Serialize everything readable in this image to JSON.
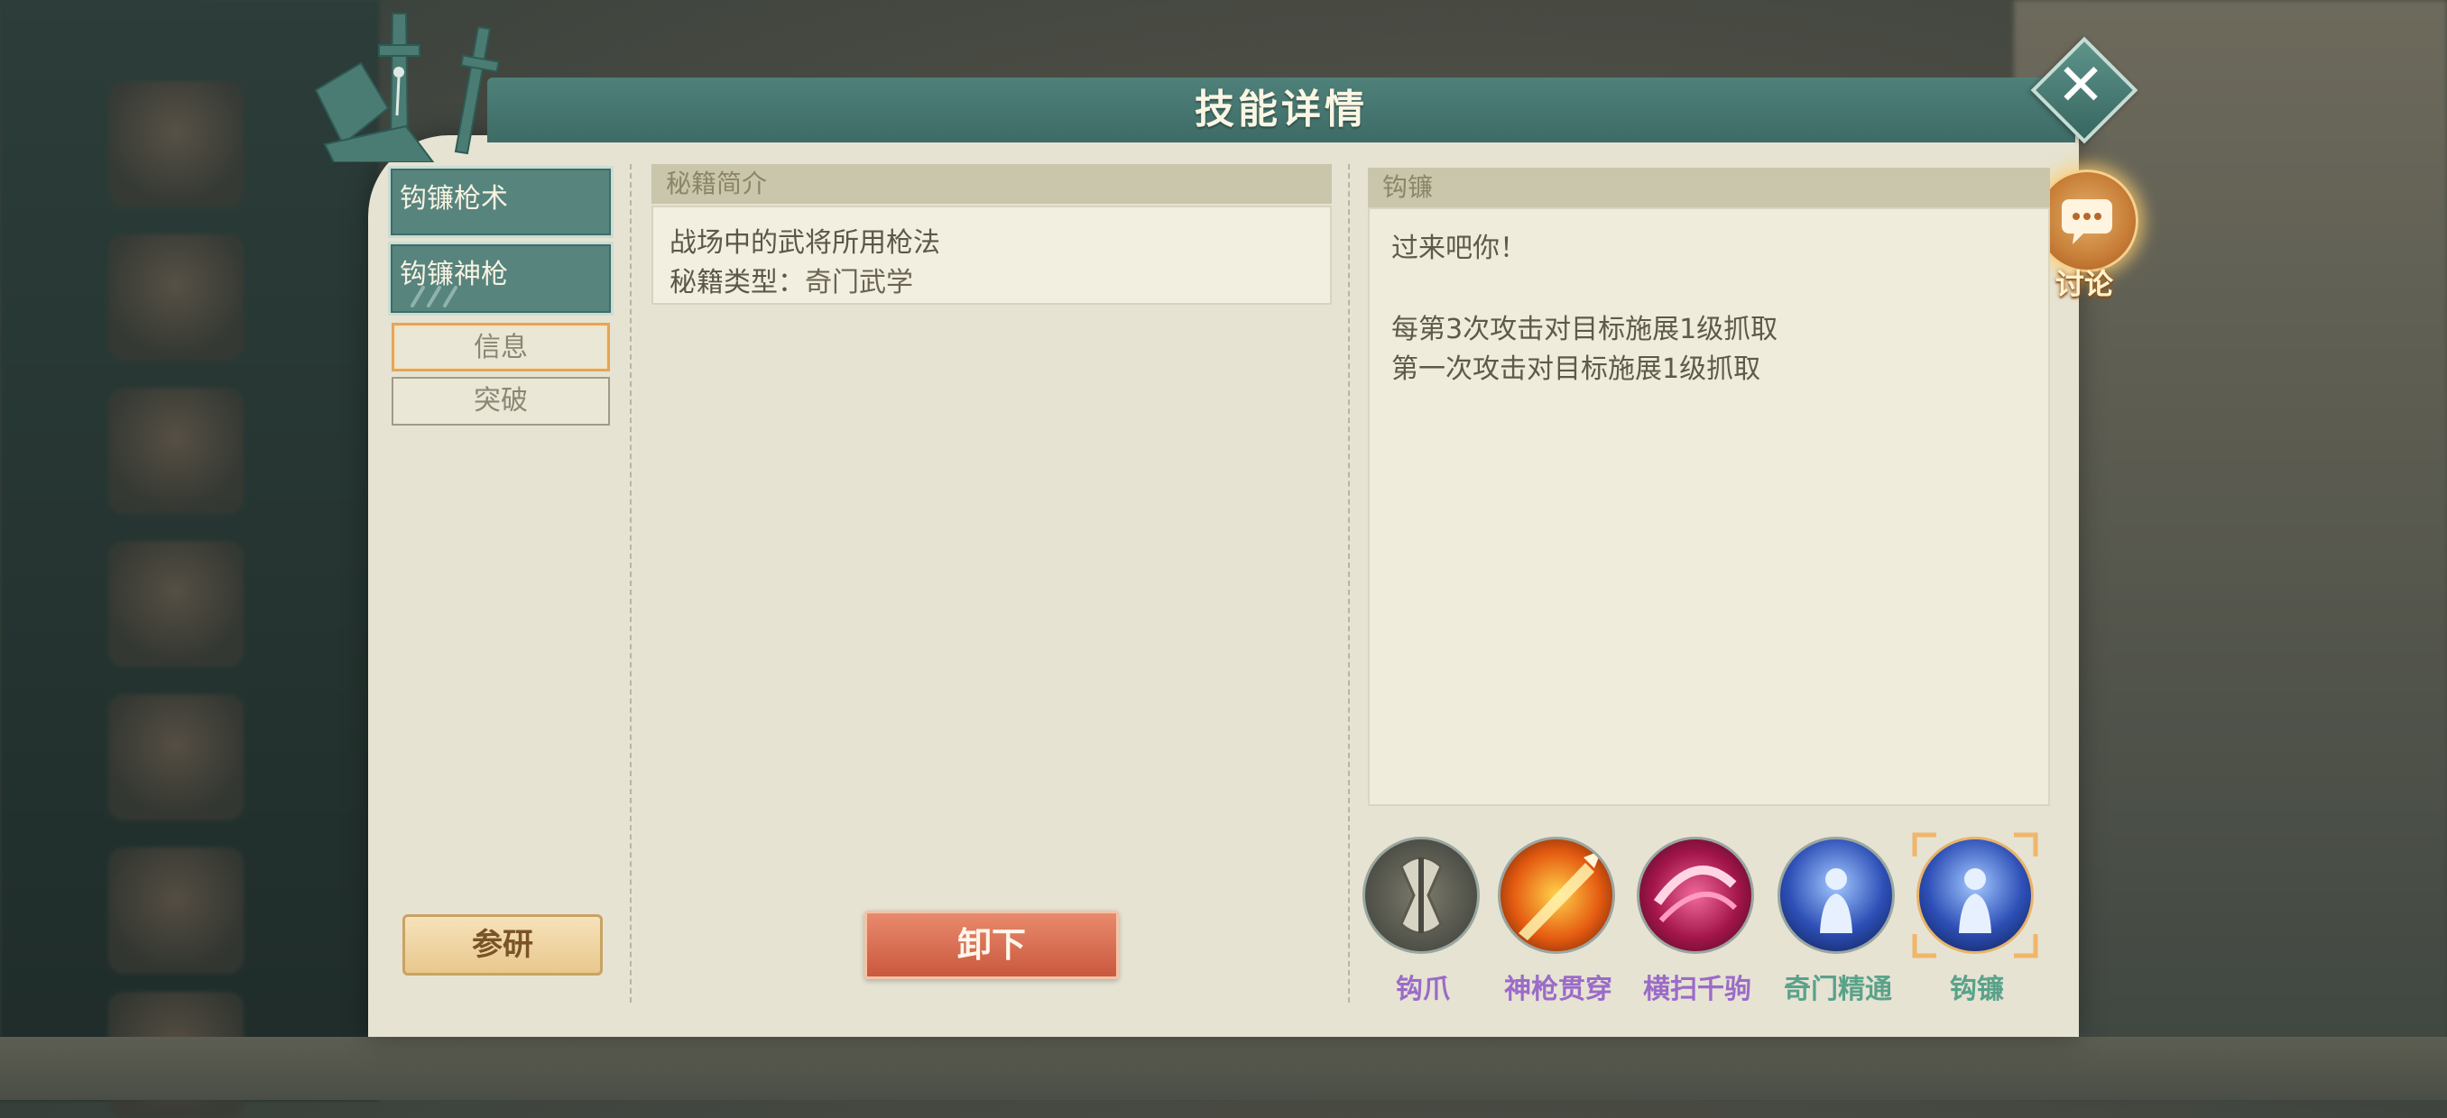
{
  "header": {
    "title": "技能详情"
  },
  "discuss": {
    "label": "讨论"
  },
  "left_panel": {
    "skill_tabs": [
      {
        "label": "钩镰枪术"
      },
      {
        "label": "钩镰神枪"
      }
    ],
    "sub_tabs": [
      {
        "label": "信息",
        "active": true
      },
      {
        "label": "突破",
        "active": false
      }
    ],
    "research_button": "参研"
  },
  "middle_panel": {
    "header": "秘籍简介",
    "description": "战场中的武将所用枪法",
    "type_label": "秘籍类型：",
    "type_value": "奇门武学",
    "unequip_button": "卸下"
  },
  "right_panel": {
    "header": "钩镰",
    "quote": "过来吧你！",
    "effects": [
      "每第3次攻击对目标施展1级抓取",
      "第一次攻击对目标施展1级抓取"
    ]
  },
  "skills": [
    {
      "name": "钩爪",
      "icon": "claw-icon",
      "color": "#9b6bc8"
    },
    {
      "name": "神枪贯穿",
      "icon": "spear-pierce-icon",
      "color": "#9b6bc8"
    },
    {
      "name": "横扫千驹",
      "icon": "sweep-icon",
      "color": "#9b6bc8"
    },
    {
      "name": "奇门精通",
      "icon": "mastery-icon",
      "color": "#5aa28a"
    },
    {
      "name": "钩镰",
      "icon": "hook-sickle-icon",
      "color": "#5aa28a",
      "selected": true
    }
  ],
  "colors": {
    "title_bar": "#3d6c66",
    "panel_bg": "#e6e3d3",
    "accent_orange": "#e3a55a",
    "unequip_red": "#c9583e"
  }
}
